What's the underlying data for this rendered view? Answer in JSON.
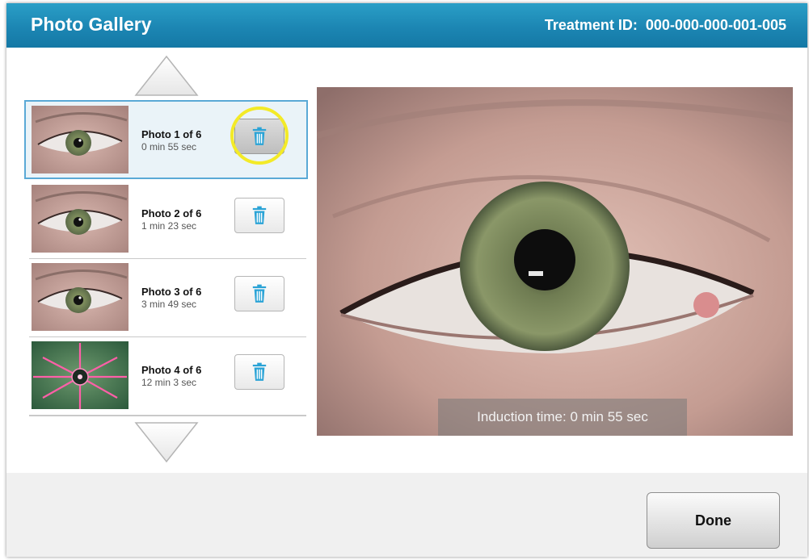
{
  "header": {
    "title": "Photo Gallery",
    "treatment_id_label": "Treatment ID:",
    "treatment_id": "000-000-000-001-005"
  },
  "gallery": {
    "items": [
      {
        "label": "Photo 1 of 6",
        "time": "0 min 55 sec",
        "selected": true
      },
      {
        "label": "Photo 2 of 6",
        "time": "1 min 23 sec",
        "selected": false
      },
      {
        "label": "Photo 3 of 6",
        "time": "3 min 49 sec",
        "selected": false
      },
      {
        "label": "Photo 4 of 6",
        "time": "12 min 3 sec",
        "selected": false
      }
    ]
  },
  "viewer": {
    "caption": "Induction time: 0 min 55 sec"
  },
  "footer": {
    "done_label": "Done"
  },
  "icons": {
    "scroll_up": "up-arrow-icon",
    "scroll_down": "down-arrow-icon",
    "delete": "trash-icon"
  },
  "colors": {
    "header": "#1c86b3",
    "highlight": "#f3ea28",
    "selected_border": "#5aa9d6"
  }
}
